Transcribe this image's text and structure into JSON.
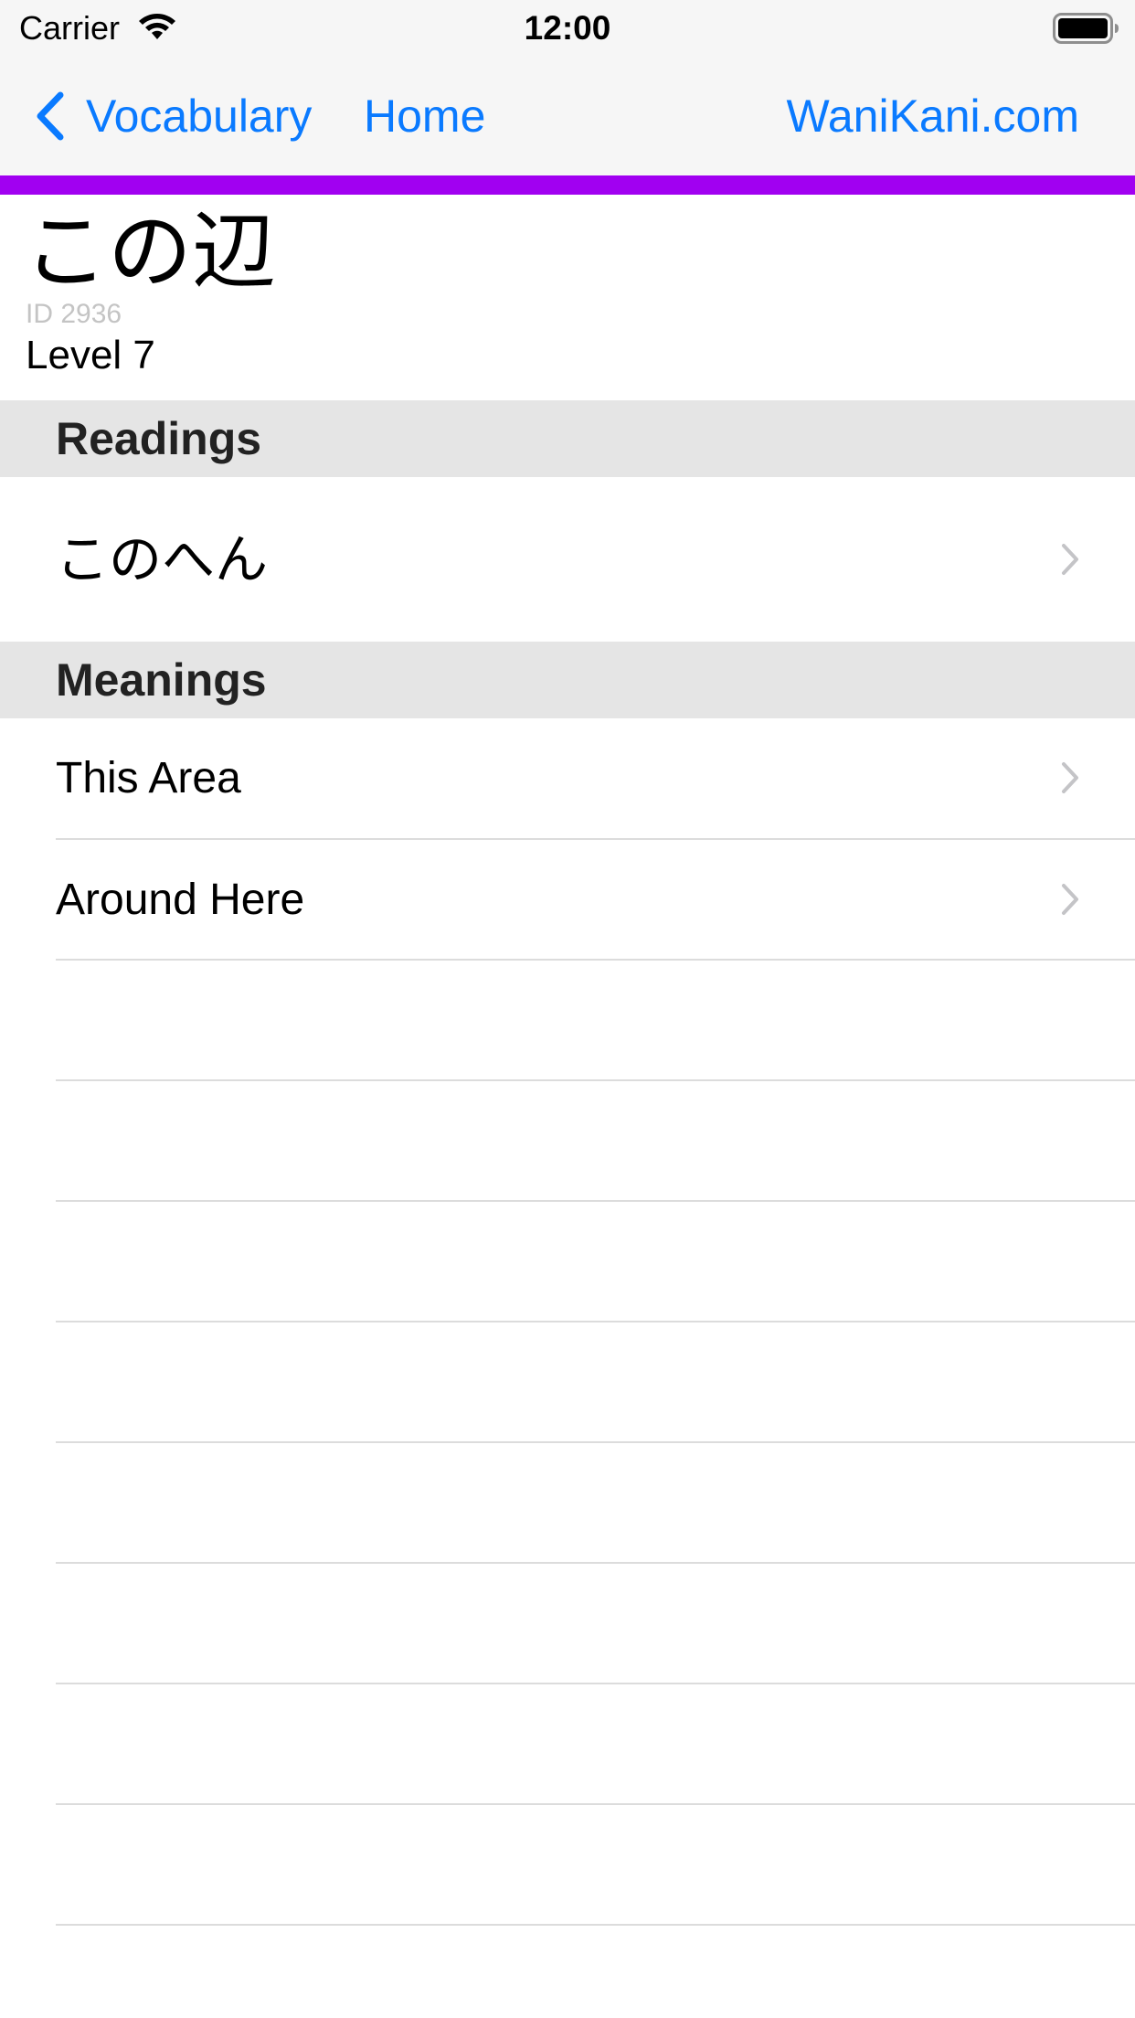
{
  "status_bar": {
    "carrier": "Carrier",
    "time": "12:00",
    "wifi_icon": "wifi-icon",
    "battery_icon": "battery-full-icon"
  },
  "nav": {
    "back_label": "Vocabulary",
    "home_label": "Home",
    "website_label": "WaniKani.com",
    "tint_color": "#0a7aff",
    "accent_color": "#a100f1"
  },
  "subject": {
    "characters": "この辺",
    "id_text": "ID 2936",
    "level_text": "Level 7"
  },
  "sections": {
    "readings": {
      "title": "Readings",
      "items": [
        "このへん"
      ]
    },
    "meanings": {
      "title": "Meanings",
      "items": [
        "This Area",
        "Around Here"
      ]
    }
  }
}
